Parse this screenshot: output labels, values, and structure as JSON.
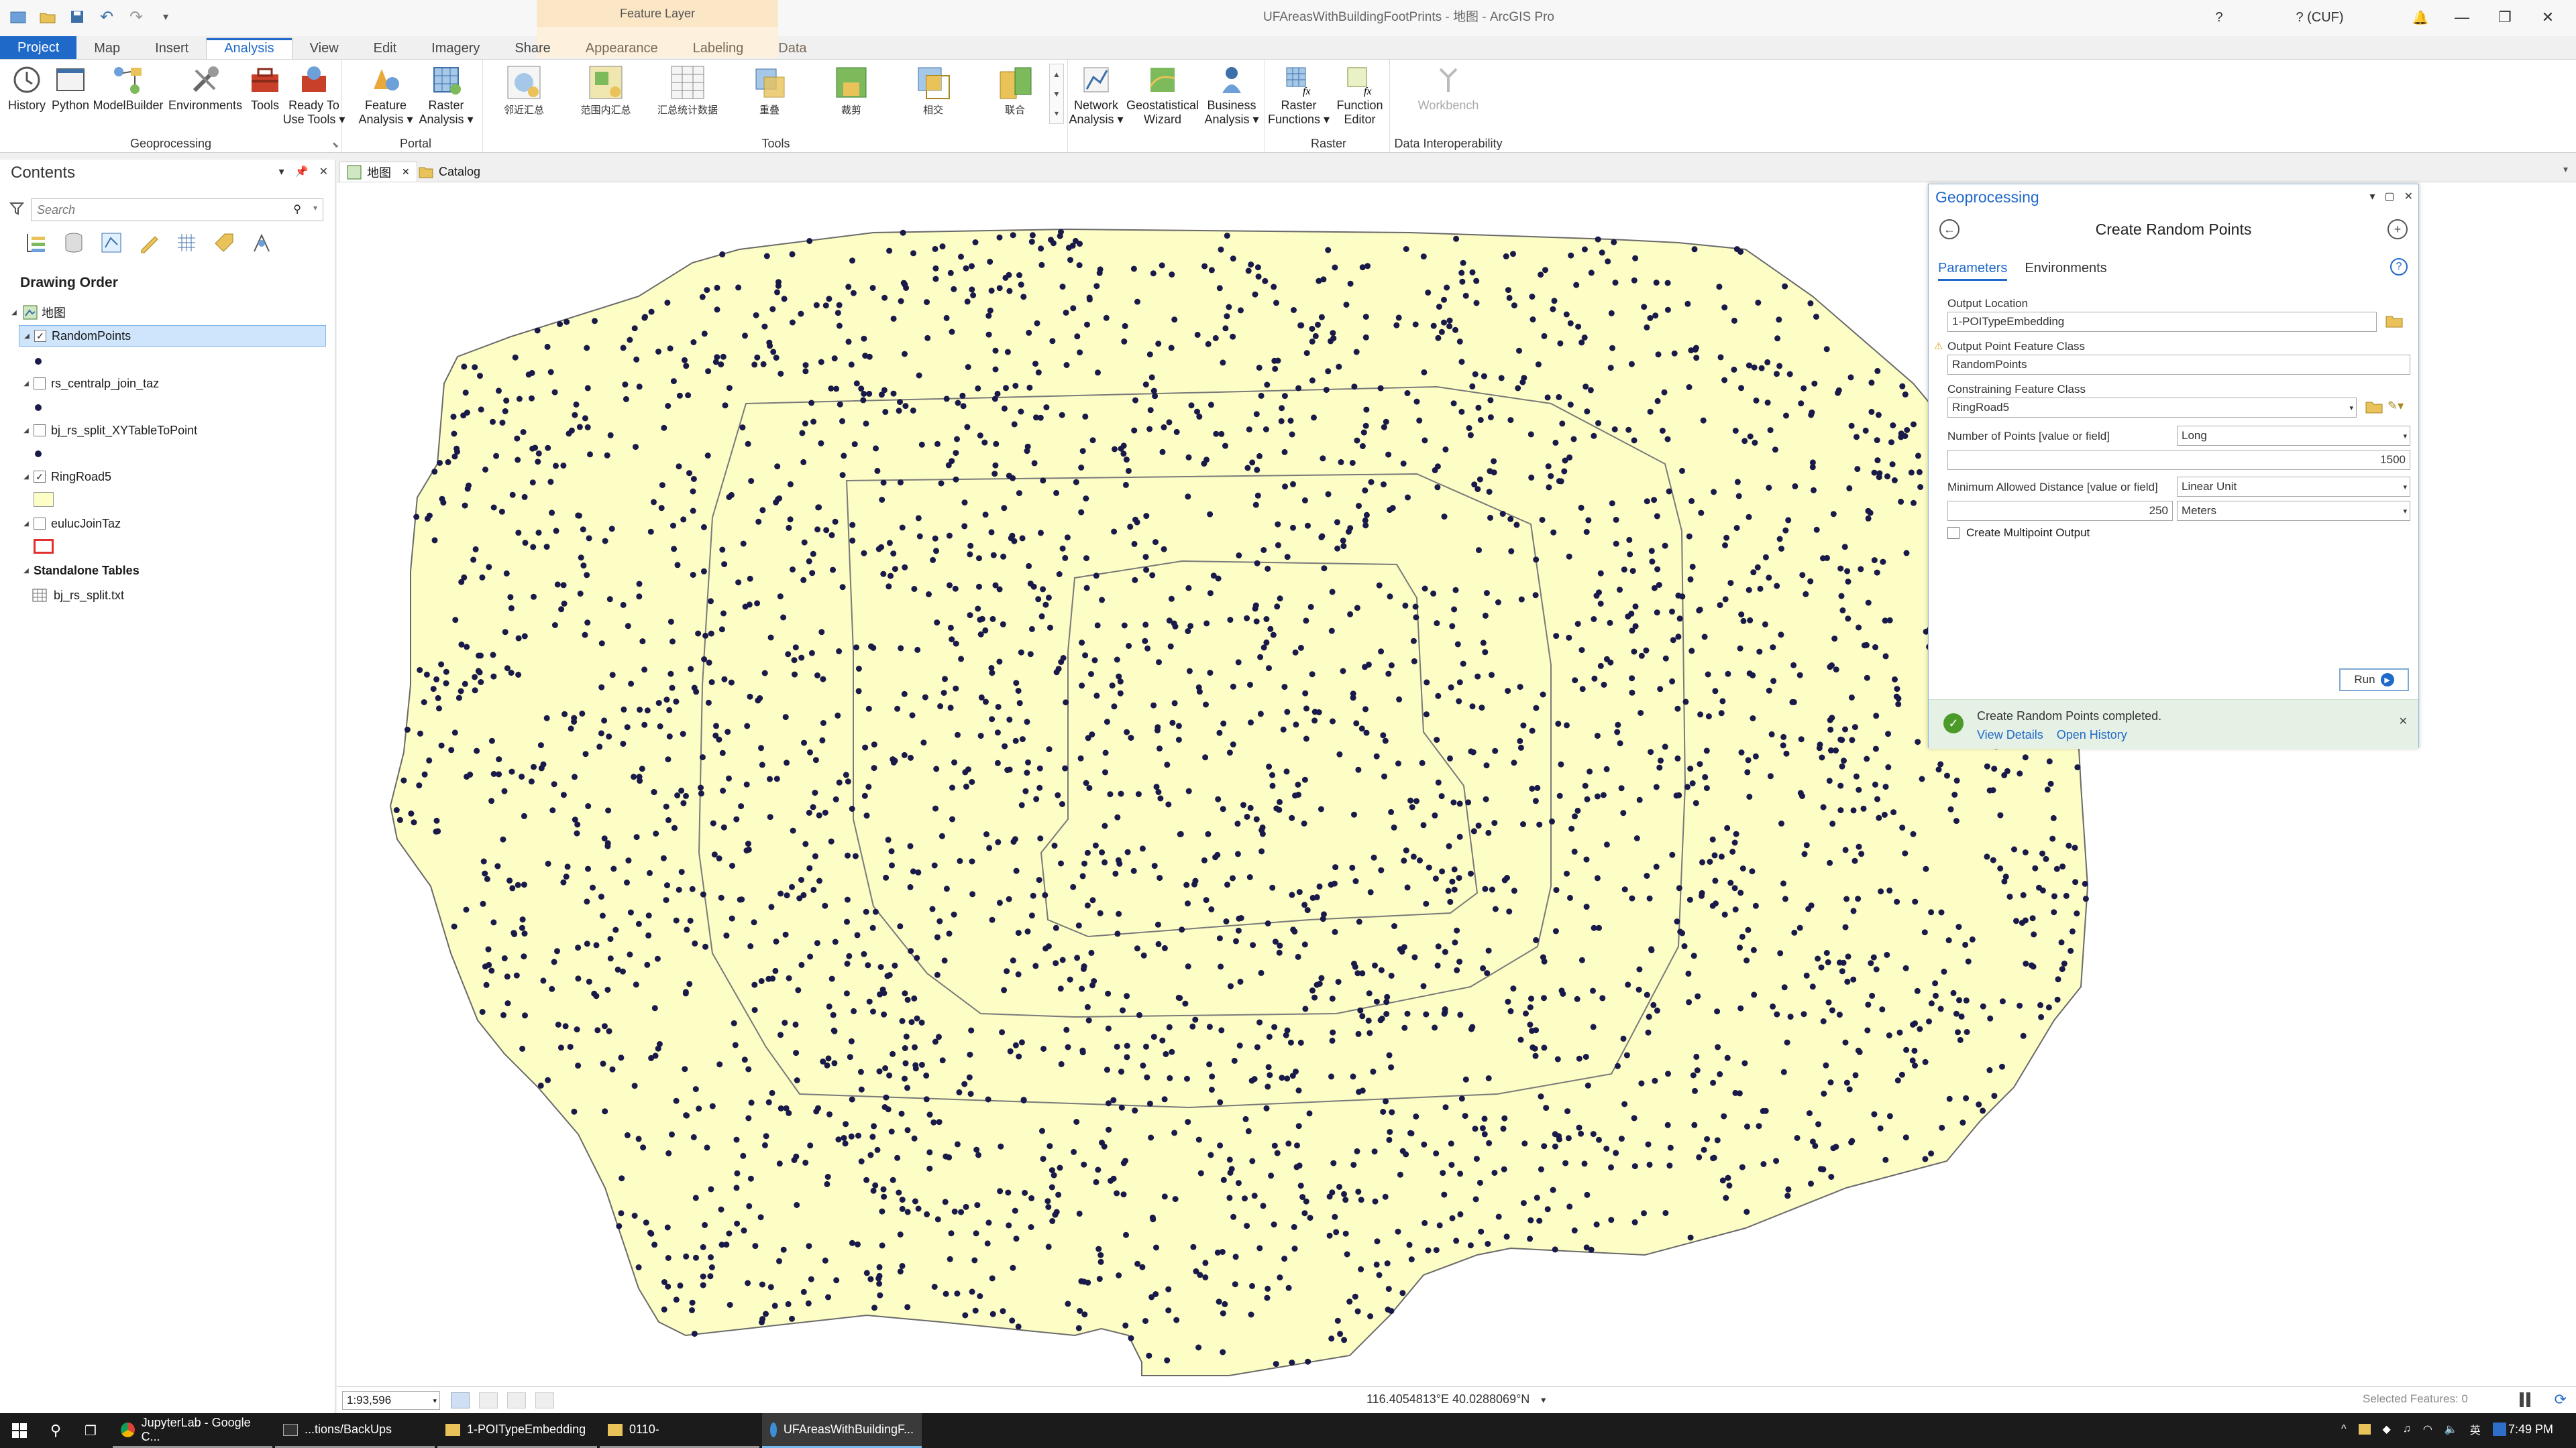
{
  "window": {
    "title": "UFAreasWithBuildingFootPrints - 地图 - ArcGIS Pro",
    "contextual_tab_group": "Feature Layer",
    "user_label": "? (CUF)"
  },
  "tabs": [
    "Project",
    "Map",
    "Insert",
    "Analysis",
    "View",
    "Edit",
    "Imagery",
    "Share",
    "Appearance",
    "Labeling",
    "Data"
  ],
  "active_tab": "Analysis",
  "ribbon": {
    "history": "History",
    "python": "Python",
    "modelbuilder": "ModelBuilder",
    "environments": "Environments",
    "tools": "Tools",
    "ready_to_use": "Ready To\nUse Tools ▾",
    "feature_analysis": "Feature\nAnalysis ▾",
    "raster_analysis": "Raster\nAnalysis ▾",
    "tool_gallery": [
      "邻近汇总",
      "范围内汇总",
      "汇总统计数据",
      "重叠",
      "裁剪",
      "相交",
      "联合"
    ],
    "network_analysis": "Network\nAnalysis ▾",
    "geostatistical_wizard": "Geostatistical\nWizard",
    "business_analysis": "Business\nAnalysis ▾",
    "raster_functions": "Raster\nFunctions ▾",
    "function_editor": "Function\nEditor",
    "workbench": "Workbench",
    "groups": {
      "geoprocessing": "Geoprocessing",
      "portal": "Portal",
      "tools": "Tools",
      "raster": "Raster",
      "data_interop": "Data Interoperability"
    }
  },
  "contents": {
    "title": "Contents",
    "search_placeholder": "Search",
    "drawing_order": "Drawing Order",
    "map_name": "地图",
    "layers": [
      {
        "name": "RandomPoints",
        "checked": true
      },
      {
        "name": "rs_centralp_join_taz",
        "checked": false
      },
      {
        "name": "bj_rs_split_XYTableToPoint",
        "checked": false
      },
      {
        "name": "RingRoad5",
        "checked": true
      },
      {
        "name": "eulucJoinTaz",
        "checked": false
      }
    ],
    "standalone_tables_label": "Standalone Tables",
    "table": "bj_rs_split.txt"
  },
  "map_tabs": {
    "map": "地图",
    "catalog": "Catalog"
  },
  "map_status": {
    "scale": "1:93,596",
    "coordinates": "116.4054813°E 40.0288069°N",
    "selected_features": "Selected Features: 0"
  },
  "geoprocessing": {
    "pane_title": "Geoprocessing",
    "tool_name": "Create Random Points",
    "tabs": [
      "Parameters",
      "Environments"
    ],
    "output_location_label": "Output Location",
    "output_location": "1-POITypeEmbedding",
    "output_fc_label": "Output Point Feature Class",
    "output_fc": "RandomPoints",
    "constraining_fc_label": "Constraining Feature Class",
    "constraining_fc": "RingRoad5",
    "num_points_label": "Number of Points [value or field]",
    "num_points_type": "Long",
    "num_points": "1500",
    "min_dist_label": "Minimum Allowed Distance [value or field]",
    "min_dist_type": "Linear Unit",
    "min_dist": "250",
    "min_dist_unit": "Meters",
    "multipoint_label": "Create Multipoint Output",
    "run": "Run",
    "message": "Create Random Points completed.",
    "view_details": "View Details",
    "open_history": "Open History"
  },
  "taskbar": {
    "items": [
      "JupyterLab - Google C...",
      "...tions/BackUps",
      "1-POITypeEmbedding",
      "0110-",
      "UFAreasWithBuildingF..."
    ],
    "time": "7:49 PM"
  },
  "colors": {
    "accent": "#1f69c9",
    "map_fill": "#fdfdc6",
    "point": "#1a1a4a",
    "ring_line": "#7a7a7a",
    "success_bg": "#e6f1e6"
  }
}
